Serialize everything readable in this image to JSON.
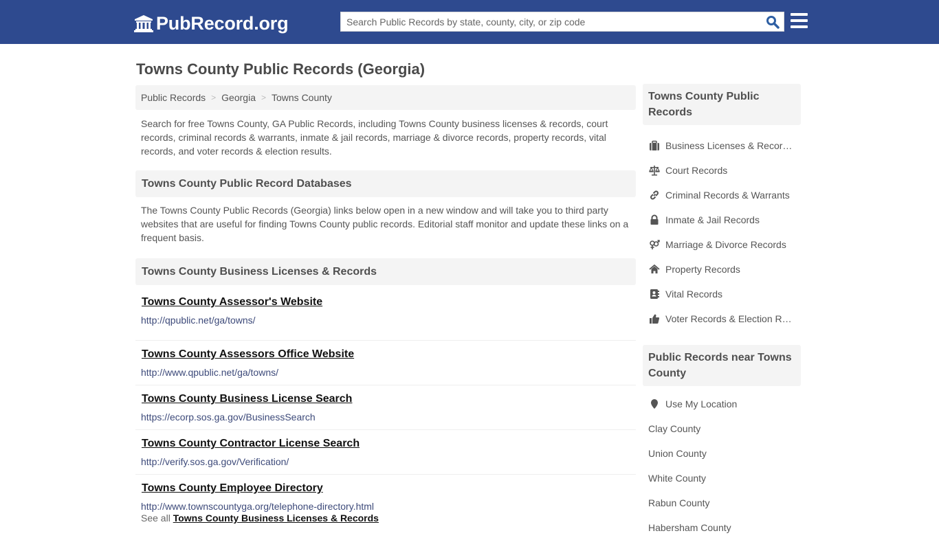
{
  "header": {
    "logo_text": "PubRecord.org",
    "search_placeholder": "Search Public Records by state, county, city, or zip code",
    "brand_color": "#2e4a8f"
  },
  "page_title": "Towns County Public Records (Georgia)",
  "breadcrumb": [
    {
      "label": "Public Records"
    },
    {
      "label": "Georgia"
    },
    {
      "label": "Towns County"
    }
  ],
  "breadcrumb_separator": ">",
  "intro": "Search for free Towns County, GA Public Records, including Towns County business licenses & records, court records, criminal records & warrants, inmate & jail records, marriage & divorce records, property records, vital records, and voter records & election results.",
  "databases": {
    "heading": "Towns County Public Record Databases",
    "description": "The Towns County Public Records (Georgia) links below open in a new window and will take you to third party websites that are useful for finding Towns County public records. Editorial staff monitor and update these links on a frequent basis."
  },
  "business": {
    "heading": "Towns County Business Licenses & Records",
    "links": [
      {
        "title": "Towns County Assessor's Website",
        "url": "http://qpublic.net/ga/towns/"
      },
      {
        "title": "Towns County Assessors Office Website",
        "url": "http://www.qpublic.net/ga/towns/"
      },
      {
        "title": "Towns County Business License Search",
        "url": "https://ecorp.sos.ga.gov/BusinessSearch"
      },
      {
        "title": "Towns County Contractor License Search",
        "url": "http://verify.sos.ga.gov/Verification/"
      },
      {
        "title": "Towns County Employee Directory",
        "url": "http://www.townscountyga.org/telephone-directory.html"
      }
    ],
    "see_all_prefix": "See all",
    "see_all_link": "Towns County Business Licenses & Records"
  },
  "sidebar": {
    "records_heading": "Towns County Public Records",
    "records": [
      {
        "label": "Business Licenses & Records",
        "icon": "briefcase-icon"
      },
      {
        "label": "Court Records",
        "icon": "scale-icon"
      },
      {
        "label": "Criminal Records & Warrants",
        "icon": "link-icon"
      },
      {
        "label": "Inmate & Jail Records",
        "icon": "lock-icon"
      },
      {
        "label": "Marriage & Divorce Records",
        "icon": "gender-icon"
      },
      {
        "label": "Property Records",
        "icon": "home-icon"
      },
      {
        "label": "Vital Records",
        "icon": "address-book-icon"
      },
      {
        "label": "Voter Records & Election Results",
        "icon": "thumbs-up-icon"
      }
    ],
    "near_heading": "Public Records near Towns County",
    "use_location": "Use My Location",
    "nearby": [
      {
        "label": "Clay County"
      },
      {
        "label": "Union County"
      },
      {
        "label": "White County"
      },
      {
        "label": "Rabun County"
      },
      {
        "label": "Habersham County"
      }
    ]
  }
}
